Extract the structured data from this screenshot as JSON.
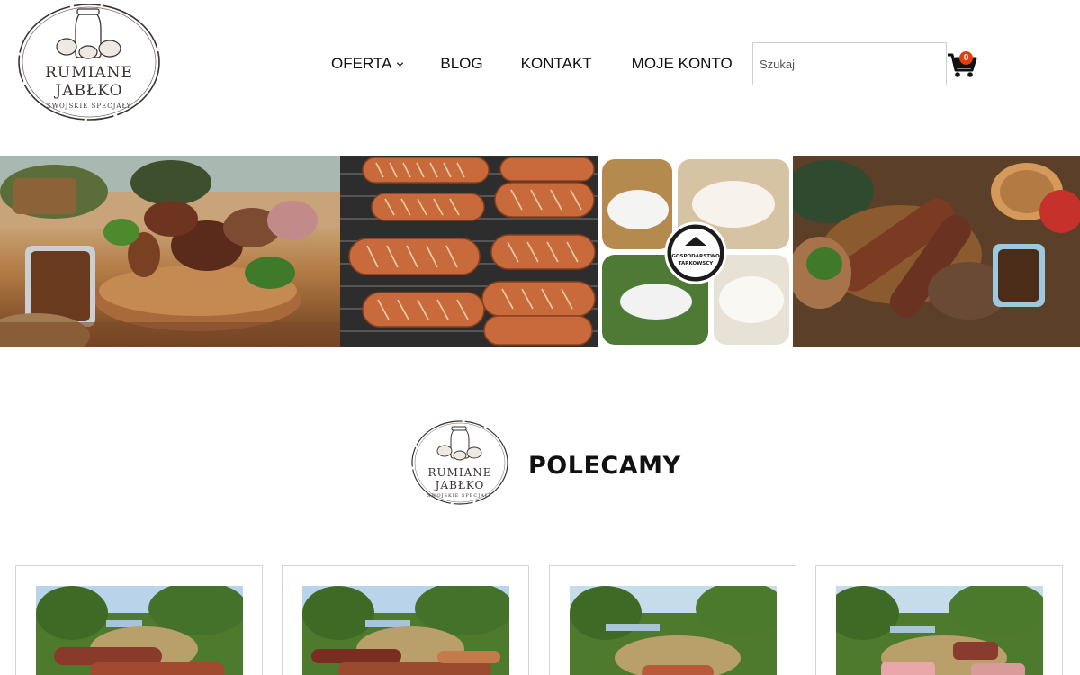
{
  "logo": {
    "line1": "RUMIANE",
    "line2": "JABŁKO",
    "line3": "SWOJSKIE SPECJAŁY"
  },
  "nav": {
    "items": [
      {
        "label": "OFERTA",
        "has_dropdown": true
      },
      {
        "label": "BLOG",
        "has_dropdown": false
      },
      {
        "label": "KONTAKT",
        "has_dropdown": false
      },
      {
        "label": "MOJE KONTO",
        "has_dropdown": false
      }
    ]
  },
  "search": {
    "placeholder": "Szukaj",
    "value": ""
  },
  "cart": {
    "icon": "cart-icon",
    "count": "0"
  },
  "section": {
    "title": "POLECAMY"
  },
  "banner_badge": {
    "line1": "GOSPODARSTWO",
    "line2": "TARKOWSCY"
  },
  "colors": {
    "accent": "#e53f10",
    "text": "#111111",
    "logo": "#3a3330",
    "border": "#d4d4d4"
  }
}
